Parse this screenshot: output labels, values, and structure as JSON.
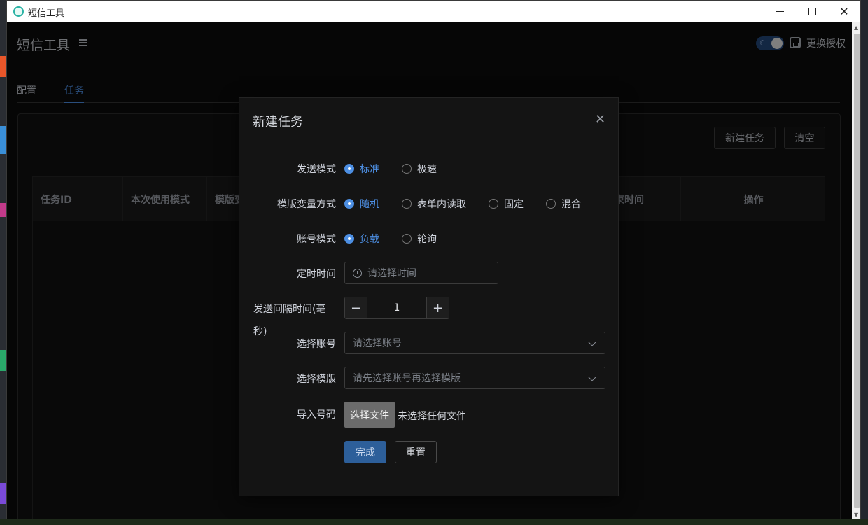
{
  "window": {
    "title": "短信工具"
  },
  "header": {
    "app_title": "短信工具",
    "auth_label": "更换授权"
  },
  "tabs": [
    {
      "label": "配置"
    },
    {
      "label": "任务"
    }
  ],
  "toolbar": {
    "new_task_label": "新建任务",
    "clear_label": "清空"
  },
  "table": {
    "columns": [
      "任务ID",
      "本次使用模式",
      "模版变",
      "束时间",
      "操作"
    ]
  },
  "dialog": {
    "title": "新建任务",
    "send_mode": {
      "label": "发送模式",
      "options": [
        "标准",
        "极速"
      ]
    },
    "var_mode": {
      "label": "模版变量方式",
      "options": [
        "随机",
        "表单内读取",
        "固定",
        "混合"
      ]
    },
    "account_mode": {
      "label": "账号模式",
      "options": [
        "负载",
        "轮询"
      ]
    },
    "schedule": {
      "label": "定时时间",
      "placeholder": "请选择时间"
    },
    "interval": {
      "label_line1": "发送间隔时间(毫",
      "label_line2": "秒)",
      "value": "1"
    },
    "account": {
      "label": "选择账号",
      "placeholder": "请选择账号"
    },
    "template": {
      "label": "选择模版",
      "placeholder": "请先选择账号再选择模版"
    },
    "import": {
      "label": "导入号码",
      "button": "选择文件",
      "status": "未选择任何文件"
    },
    "submit_label": "完成",
    "reset_label": "重置"
  }
}
